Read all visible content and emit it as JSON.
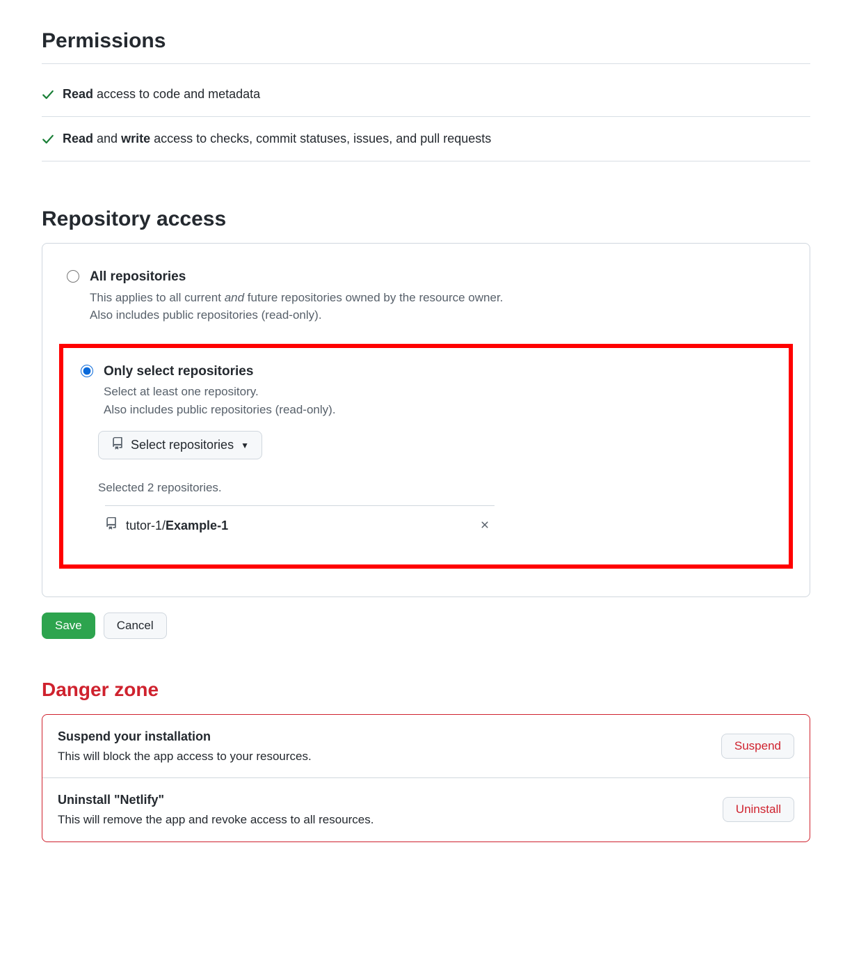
{
  "permissions": {
    "title": "Permissions",
    "items": [
      {
        "bold1": "Read",
        "rest": " access to code and metadata"
      },
      {
        "bold1": "Read",
        "mid": " and ",
        "bold2": "write",
        "rest": " access to checks, commit statuses, issues, and pull requests"
      }
    ]
  },
  "repo_access": {
    "title": "Repository access",
    "options": {
      "all": {
        "label": "All repositories",
        "desc_prefix": "This applies to all current ",
        "desc_em": "and",
        "desc_suffix": " future repositories owned by the resource owner.",
        "desc_line2": "Also includes public repositories (read-only)."
      },
      "only": {
        "label": "Only select repositories",
        "desc_line1": "Select at least one repository.",
        "desc_line2": "Also includes public repositories (read-only).",
        "select_button": "Select repositories",
        "selected_count": "Selected 2 repositories.",
        "selected_repo_owner": "tutor-1/",
        "selected_repo_name": "Example-1"
      }
    }
  },
  "actions": {
    "save": "Save",
    "cancel": "Cancel"
  },
  "danger": {
    "title": "Danger zone",
    "rows": [
      {
        "title": "Suspend your installation",
        "desc": "This will block the app access to your resources.",
        "button": "Suspend"
      },
      {
        "title": "Uninstall \"Netlify\"",
        "desc": "This will remove the app and revoke access to all resources.",
        "button": "Uninstall"
      }
    ]
  }
}
